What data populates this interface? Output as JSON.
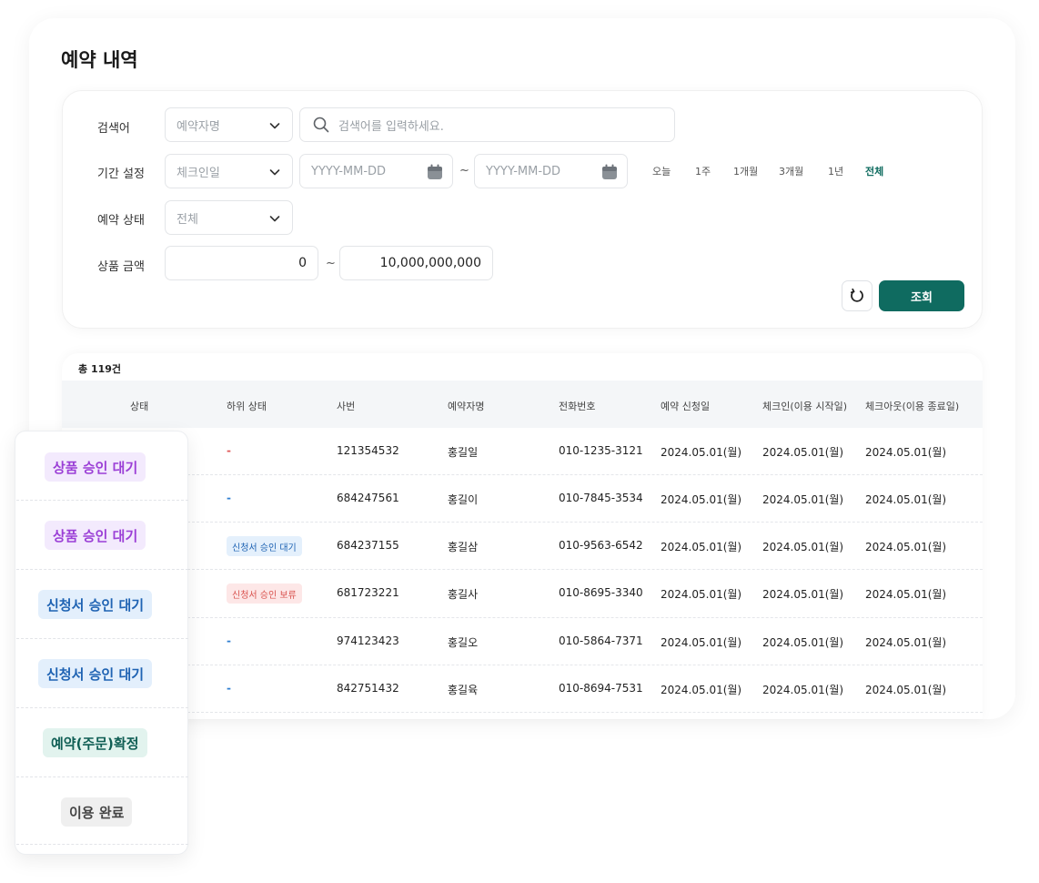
{
  "page": {
    "title": "예약 내역"
  },
  "filters": {
    "keyword": {
      "label": "검색어",
      "select": "예약자명",
      "placeholder": "검색어를 입력하세요."
    },
    "period": {
      "label": "기간 설정",
      "select": "체크인일",
      "start_placeholder": "YYYY-MM-DD",
      "end_placeholder": "YYYY-MM-DD",
      "separator": "~",
      "quick": [
        "오늘",
        "1주",
        "1개월",
        "3개월",
        "1년",
        "전체"
      ],
      "active": "전체"
    },
    "status": {
      "label": "예약 상태",
      "select": "전체"
    },
    "amount": {
      "label": "상품 금액",
      "min": "0",
      "max": "10,000,000,000",
      "separator": "~"
    },
    "search_label": "조회",
    "reset_icon": "refresh-icon"
  },
  "table": {
    "total": "총 119건",
    "columns": [
      "상태",
      "하위 상태",
      "사번",
      "예약자명",
      "전화번호",
      "예약 신청일",
      "체크인(이용 시작일)",
      "체크아웃(이용 종료일)"
    ],
    "rows": [
      {
        "substatus": "-",
        "substatus_color": "red",
        "id": "121354532",
        "name": "홍길일",
        "phone": "010-1235-3121",
        "applied": "2024.05.01(월)",
        "checkin": "2024.05.01(월)",
        "checkout": "2024.05.01(월)"
      },
      {
        "substatus": "-",
        "substatus_color": "blue",
        "id": "684247561",
        "name": "홍길이",
        "phone": "010-7845-3534",
        "applied": "2024.05.01(월)",
        "checkin": "2024.05.01(월)",
        "checkout": "2024.05.01(월)"
      },
      {
        "substatus": "신청서 승인 대기",
        "substatus_color": "blue-badge",
        "id": "684237155",
        "name": "홍길삼",
        "phone": "010-9563-6542",
        "applied": "2024.05.01(월)",
        "checkin": "2024.05.01(월)",
        "checkout": "2024.05.01(월)"
      },
      {
        "substatus": "신청서 승인 보류",
        "substatus_color": "red-badge",
        "id": "681723221",
        "name": "홍길사",
        "phone": "010-8695-3340",
        "applied": "2024.05.01(월)",
        "checkin": "2024.05.01(월)",
        "checkout": "2024.05.01(월)"
      },
      {
        "substatus": "-",
        "substatus_color": "blue",
        "id": "974123423",
        "name": "홍길오",
        "phone": "010-5864-7371",
        "applied": "2024.05.01(월)",
        "checkin": "2024.05.01(월)",
        "checkout": "2024.05.01(월)"
      },
      {
        "substatus": "-",
        "substatus_color": "blue",
        "id": "842751432",
        "name": "홍길육",
        "phone": "010-8694-7531",
        "applied": "2024.05.01(월)",
        "checkin": "2024.05.01(월)",
        "checkout": "2024.05.01(월)"
      }
    ]
  },
  "status_card": {
    "items": [
      {
        "label": "상품 승인 대기",
        "style": "purple"
      },
      {
        "label": "상품 승인 대기",
        "style": "purple"
      },
      {
        "label": "신청서 승인 대기",
        "style": "blue"
      },
      {
        "label": "신청서 승인 대기",
        "style": "blue"
      },
      {
        "label": "예약(주문)확정",
        "style": "green"
      },
      {
        "label": "이용 완료",
        "style": "gray"
      }
    ]
  },
  "colors": {
    "primary": "#0f6b60",
    "purple": "#9b3fd6",
    "blue": "#1f63b3",
    "red": "#d9534f"
  }
}
